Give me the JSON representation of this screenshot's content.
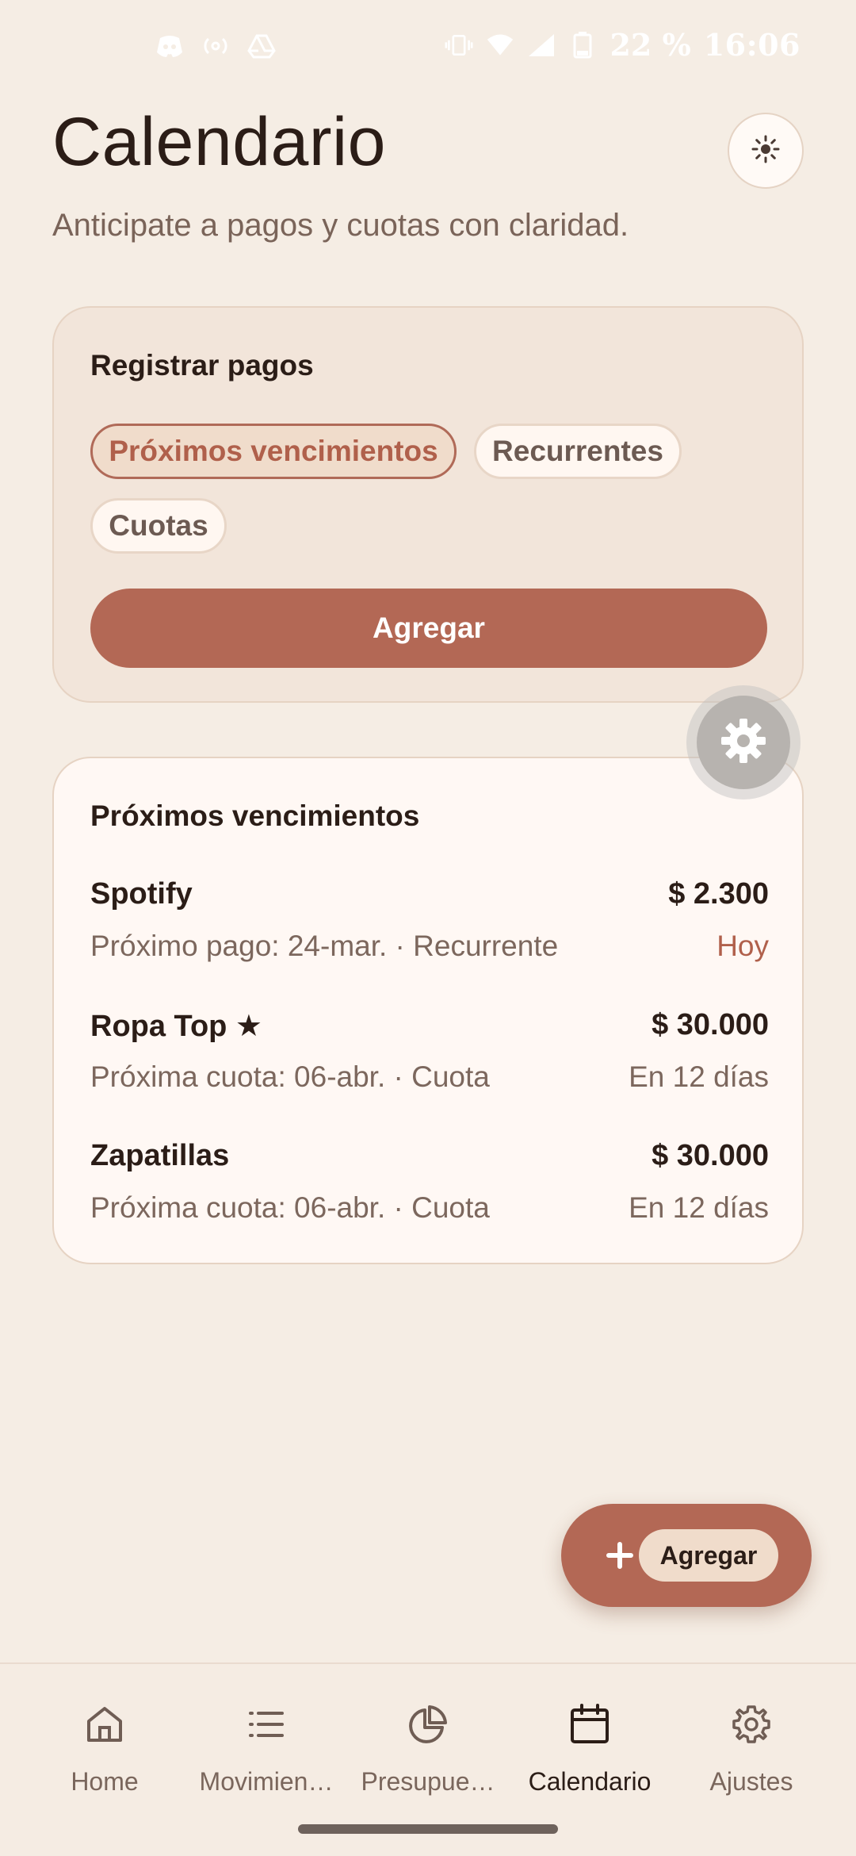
{
  "status_bar": {
    "battery": "22 %",
    "time": "16:06",
    "left_icons": [
      "discord-icon",
      "radio-broadcast-icon",
      "drive-icon"
    ],
    "right_icons": [
      "vibrate-icon",
      "wifi-icon",
      "signal-icon",
      "battery-icon"
    ]
  },
  "header": {
    "title": "Calendario",
    "subtitle": "Anticipate a pagos y cuotas con claridad.",
    "theme_icon": "sun-icon"
  },
  "register": {
    "heading": "Registrar pagos",
    "chips": [
      {
        "label": "Próximos vencimientos",
        "active": true
      },
      {
        "label": "Recurrentes",
        "active": false
      },
      {
        "label": "Cuotas",
        "active": false
      }
    ],
    "button_label": "Agregar"
  },
  "upcoming": {
    "heading": "Próximos vencimientos",
    "items": [
      {
        "name": "Spotify",
        "amount": "$ 2.300",
        "detail": "Próximo pago: 24-mar. · Recurrente",
        "when": "Hoy"
      },
      {
        "name": "Ropa Top ★",
        "amount": "$ 30.000",
        "detail": "Próxima cuota: 06-abr. · Cuota",
        "when": "En 12 días"
      },
      {
        "name": "Zapatillas",
        "amount": "$ 30.000",
        "detail": "Próxima cuota: 06-abr. · Cuota",
        "when": "En 12 días"
      }
    ]
  },
  "fab": {
    "label": "Agregar",
    "icon": "plus-icon"
  },
  "nav": {
    "items": [
      {
        "label": "Home",
        "icon": "home-icon",
        "active": false
      },
      {
        "label": "Movimien…",
        "icon": "list-icon",
        "active": false
      },
      {
        "label": "Presupue…",
        "icon": "pie-chart-icon",
        "active": false
      },
      {
        "label": "Calendario",
        "icon": "calendar-icon",
        "active": true
      },
      {
        "label": "Ajustes",
        "icon": "settings-icon",
        "active": false
      }
    ]
  },
  "colors": {
    "background": "#F5EDE4",
    "accent": "#B36855",
    "chip_active_text": "#B0604B",
    "text_primary": "#2B1D17",
    "text_secondary": "#7C675D"
  }
}
